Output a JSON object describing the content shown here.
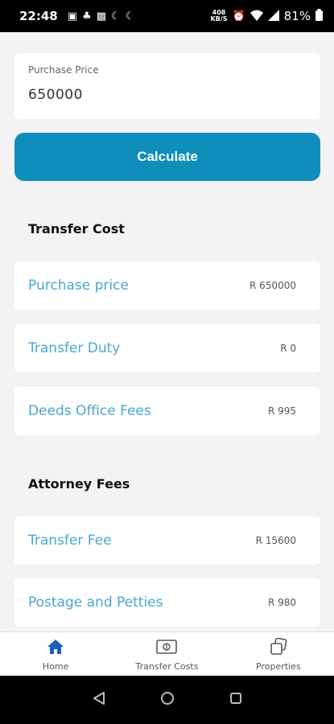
{
  "status_bar": {
    "time": "22:48",
    "battery": "81%",
    "data_rate": "408",
    "data_unit": "KB/S",
    "left_icons": [
      "media-icon",
      "notification-icon",
      "gallery-icon",
      "moon-icon",
      "moon-icon"
    ],
    "right_icons": [
      "alarm-icon",
      "wifi-icon",
      "signal-icon",
      "battery-icon"
    ]
  },
  "purchase": {
    "label": "Purchase Price",
    "value": "650000"
  },
  "calculate_label": "Calculate",
  "transfer_cost": {
    "title": "Transfer Cost",
    "rows": [
      {
        "label": "Purchase price",
        "value": "R 650000"
      },
      {
        "label": "Transfer Duty",
        "value": "R 0"
      },
      {
        "label": "Deeds Office Fees",
        "value": "R 995"
      }
    ]
  },
  "attorney_fees": {
    "title": "Attorney Fees",
    "rows": [
      {
        "label": "Transfer Fee",
        "value": "R 15600"
      },
      {
        "label": "Postage and Petties",
        "value": "R 980"
      }
    ]
  },
  "bottom_nav": {
    "items": [
      {
        "label": "Home",
        "icon": "home-icon"
      },
      {
        "label": "Transfer Costs",
        "icon": "money-icon"
      },
      {
        "label": "Properties",
        "icon": "properties-icon"
      }
    ]
  },
  "colors": {
    "accent": "#0f8ebc",
    "row_label": "#4aa7cf",
    "background": "#f3f3f3",
    "home_icon": "#1560c0"
  }
}
